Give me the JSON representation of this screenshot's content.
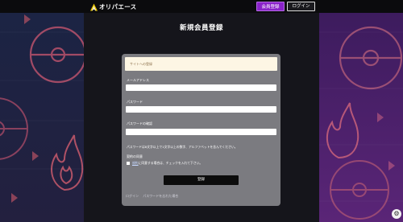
{
  "header": {
    "logo_text": "オリパエース",
    "register_label": "会員登録",
    "login_label": "ログイン"
  },
  "page_title": "新規会員登録",
  "form": {
    "notice": "サイトへの登録",
    "email_label": "メールアドレス",
    "password_label": "パスワード",
    "password_confirm_label": "パスワードの確認",
    "password_hint": "パスワードは8文字以上で1文字以上の数字、アルファベットを含んでください。",
    "terms_heading": "契約の同意",
    "terms_link": "規約",
    "terms_text": "に同意する場合は、チェックを入れて下さい。",
    "submit_label": "登録",
    "footer_login": "ログイン",
    "footer_forgot": "パスワードを忘れた場合"
  },
  "colors": {
    "accent": "#8a22c9",
    "left_bg": "#1f2a48",
    "right_bg": "#4a1e6e"
  },
  "icons": [
    "logo-mark-icon",
    "gear-icon",
    "pokeball-icon",
    "flame-icon"
  ]
}
